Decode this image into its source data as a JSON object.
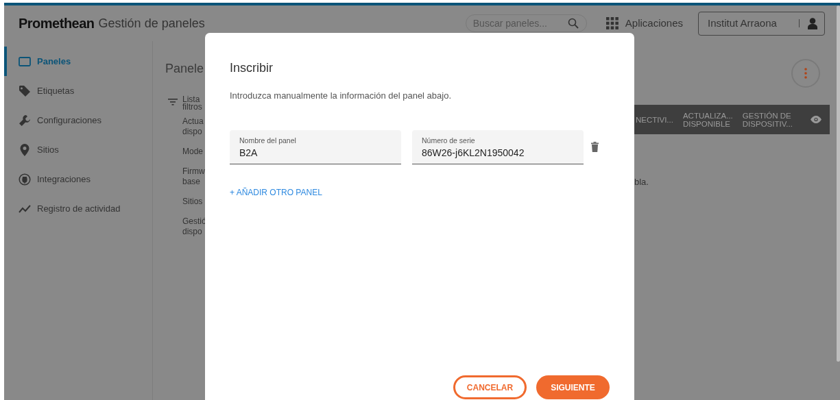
{
  "header": {
    "logo": "Promethean",
    "title": "Gestión de paneles",
    "search": {
      "placeholder": "Buscar paneles..."
    },
    "apps_button": "Aplicaciones",
    "account_button": "Institut Arraona"
  },
  "sidebar": {
    "items": [
      {
        "label": "Paneles",
        "selected": true
      },
      {
        "label": "Etiquetas",
        "selected": false
      },
      {
        "label": "Configuraciones",
        "selected": false
      },
      {
        "label": "Sitios",
        "selected": false
      },
      {
        "label": "Integraciones",
        "selected": false
      },
      {
        "label": "Registro de actividad",
        "selected": false
      }
    ]
  },
  "content": {
    "title": "Panele",
    "filter_title": "Lista\nfiltros",
    "filters": [
      "Actua\ndispo",
      "Mode",
      "Firmw\nbase",
      "Sitios",
      "Gestió\ndispo"
    ],
    "table_columns": [
      "NECTIVI...",
      "ACTUALIZA...\nDISPONIBLE",
      "GESTIÓN DE\nDISPOSITIV..."
    ],
    "empty_message": "bla."
  },
  "dialog": {
    "title": "Inscribir",
    "description": "Introduzca manualmente la información del panel abajo.",
    "fields": [
      {
        "label": "Nombre del panel",
        "value": "B2A"
      },
      {
        "label": "Número de serie",
        "value": "86W26-j6KL2N1950042"
      }
    ],
    "add_link": "+ AÑADIR OTRO PANEL",
    "buttons": [
      {
        "label": "CANCELAR",
        "kind": "outline"
      },
      {
        "label": "SIGUIENTE",
        "kind": "primary"
      }
    ]
  }
}
